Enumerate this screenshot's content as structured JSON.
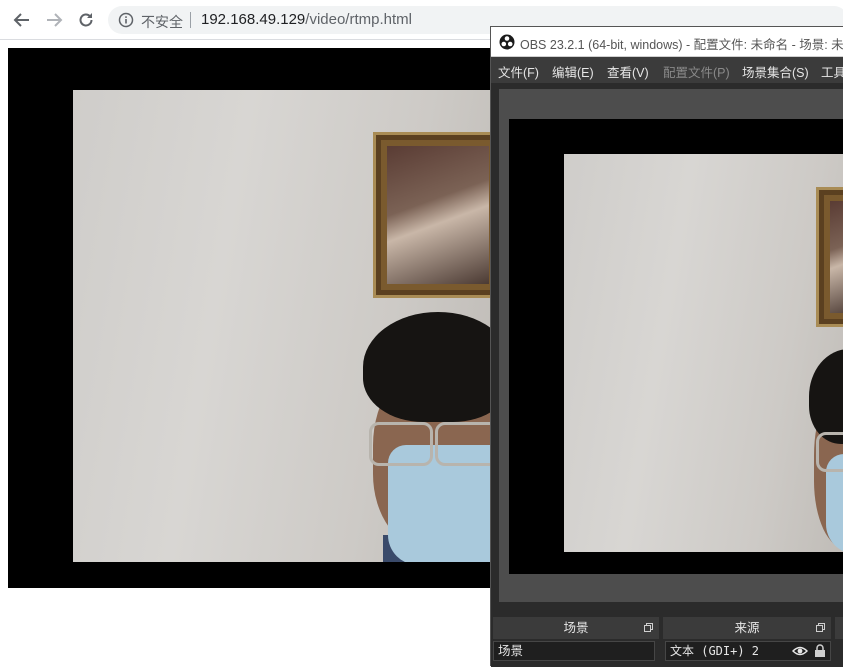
{
  "browser": {
    "security_label": "不安全",
    "url_host": "192.168.49.129",
    "url_path": "/video/rtmp.html"
  },
  "obs": {
    "title": "OBS 23.2.1 (64-bit, windows) - 配置文件: 未命名 - 场景: 未",
    "menu": [
      {
        "label": "文件(F)",
        "enabled": true
      },
      {
        "label": "编辑(E)",
        "enabled": true
      },
      {
        "label": "查看(V)",
        "enabled": true
      },
      {
        "label": "配置文件(P)",
        "enabled": false
      },
      {
        "label": "场景集合(S)",
        "enabled": true
      },
      {
        "label": "工具",
        "enabled": true
      }
    ],
    "docks": {
      "scenes_title": "场景",
      "sources_title": "来源",
      "scene_item": "场景",
      "source_item": "文本 (GDI+) 2"
    }
  },
  "colors": {
    "obs_bg": "#2b2b2b",
    "obs_panel": "#3b3b3b",
    "preview_bg": "#4d4d4d"
  }
}
